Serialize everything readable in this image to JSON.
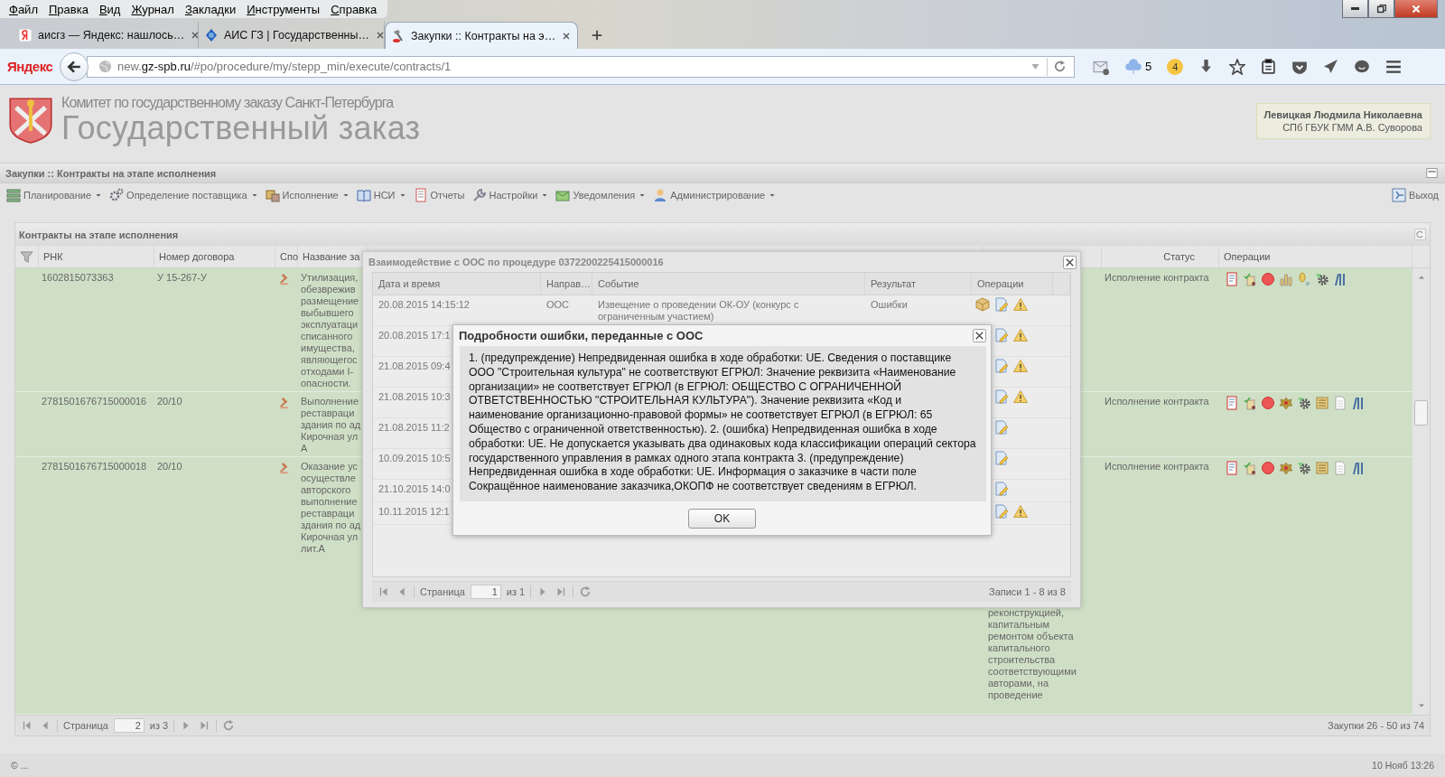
{
  "menu_bar": [
    "Файл",
    "Правка",
    "Вид",
    "Журнал",
    "Закладки",
    "Инструменты",
    "Справка"
  ],
  "browser_tabs": [
    {
      "title": "аисгз — Яндекс: нашлось…",
      "selected": false,
      "kind": "yandex"
    },
    {
      "title": "АИС ГЗ | Государственны…",
      "selected": false,
      "kind": "globe"
    },
    {
      "title": "Закупки :: Контракты на э…",
      "selected": true,
      "kind": "hammer"
    }
  ],
  "address_bar": {
    "brand": "Яндекс",
    "url": "new.**gz-spb.ru**/#po/procedure/my/stepp_min/execute/contracts/1",
    "cloud_count": "5",
    "badge_count": "4"
  },
  "header": {
    "subtitle": "Комитет по государственному заказу Санкт-Петербурга",
    "title": "Государственный заказ",
    "user_name": "Левицкая Людмила Николаевна",
    "user_org": "СПб ГБУК ГММ А.В. Суворова"
  },
  "section_title": "Закупки :: Контракты на этапе исполнения",
  "nav_menu": [
    {
      "label": "Планирование",
      "has_menu": true,
      "kind": "planning"
    },
    {
      "label": "Определение поставщика",
      "has_menu": true,
      "kind": "supplier"
    },
    {
      "label": "Исполнение",
      "has_menu": true,
      "kind": "execution"
    },
    {
      "label": "НСИ",
      "has_menu": true,
      "kind": "nsi"
    },
    {
      "label": "Отчеты",
      "has_menu": false,
      "kind": "reports"
    },
    {
      "label": "Настройки",
      "has_menu": true,
      "kind": "settings"
    },
    {
      "label": "Уведомления",
      "has_menu": true,
      "kind": "notifications"
    },
    {
      "label": "Администрирование",
      "has_menu": true,
      "kind": "admin"
    }
  ],
  "logout": "Выход",
  "grid": {
    "title": "Контракты на этапе исполнения",
    "columns": [
      "РНК",
      "Номер договора",
      "Спо",
      "Название за",
      "Статус",
      "Операции"
    ],
    "rows": [
      {
        "rnk": "1602815073363",
        "number": "У 15-267-У",
        "name": "Утилизация,\nобезврежив\nразмещение\nвыбывшего\nэксплуатаци\nсписанного\nимущества,\nявляющегос\nотходами I-\nопасности.",
        "column_6": "",
        "status": "Исполнение контракта",
        "operations": [
          {
            "kind": "report"
          },
          {
            "kind": "approve"
          },
          {
            "kind": "stop"
          },
          {
            "kind": "chart"
          },
          {
            "kind": "coin"
          },
          {
            "kind": "gear"
          },
          {
            "kind": "books"
          }
        ]
      },
      {
        "rnk": "2781501676715000016",
        "number": "20/10",
        "name": "Выполнение\nреставраци\nздания по ад\nКирочная ул\nА",
        "column_6": "",
        "status": "Исполнение контракта",
        "operations": [
          {
            "kind": "report"
          },
          {
            "kind": "approve"
          },
          {
            "kind": "stop"
          },
          {
            "kind": "emblem"
          },
          {
            "kind": "gear"
          },
          {
            "kind": "scroll"
          },
          {
            "kind": "page"
          },
          {
            "kind": "books"
          }
        ]
      },
      {
        "rnk": "2781501676715000018",
        "number": "20/10",
        "name": "Оказание ус\nосуществле\nавторского\nвыполнение\nреставраци\nздания по ад\nКирочная ул\nлит.А",
        "column_6": "реконструкцией,\nкапитальным\nремонтом объекта\nкапитального\nстроительства\nсоответствующими\nавторами, на\nпроведение",
        "status": "Исполнение контракта",
        "operations": [
          {
            "kind": "report"
          },
          {
            "kind": "approve"
          },
          {
            "kind": "stop"
          },
          {
            "kind": "emblem"
          },
          {
            "kind": "gear"
          },
          {
            "kind": "scroll"
          },
          {
            "kind": "page"
          },
          {
            "kind": "books"
          }
        ]
      }
    ],
    "pager": {
      "page_label": "Страница",
      "page": "2",
      "of": "из 3",
      "summary": "Закупки 26 - 50 из 74"
    }
  },
  "interaction_dialog": {
    "title": "Взаимодействие с ООС по процедуре 0372200225415000016",
    "columns": [
      "Дата и время",
      "Направ…",
      "Событие",
      "Результат",
      "Операции"
    ],
    "rows": [
      {
        "date": "20.08.2015 14:15:12",
        "direction": "ООС",
        "event": "Извещение о проведении ОК-ОУ (конкурс с ограниченным участием)",
        "result": "Ошибки",
        "operations": [
          {
            "kind": "package"
          },
          {
            "kind": "edit"
          },
          {
            "kind": "warning"
          }
        ]
      },
      {
        "date": "20.08.2015 17:1",
        "operations": [
          {
            "kind": "edit"
          },
          {
            "kind": "warning"
          }
        ]
      },
      {
        "date": "21.08.2015 09:4",
        "operations": [
          {
            "kind": "edit"
          },
          {
            "kind": "warning"
          }
        ]
      },
      {
        "date": "21.08.2015 10:3",
        "operations": [
          {
            "kind": "edit"
          },
          {
            "kind": "warning"
          }
        ]
      },
      {
        "date": "21.08.2015 11:2",
        "operations": [
          {
            "kind": "edit"
          }
        ]
      },
      {
        "date": "10.09.2015 10:5",
        "operations": [
          {
            "kind": "edit"
          }
        ]
      },
      {
        "date": "21.10.2015 14:0",
        "operations": [
          {
            "kind": "edit"
          }
        ]
      },
      {
        "date": "10.11.2015 12:1",
        "operations": [
          {
            "kind": "edit"
          },
          {
            "kind": "warning"
          }
        ]
      }
    ],
    "pager": {
      "page_label": "Страница",
      "page": "1",
      "of": "из 1",
      "summary": "Записи 1 - 8 из 8"
    }
  },
  "error_dialog": {
    "title": "Подробности ошибки, переданные с ООС",
    "message": "1. (предупреждение) Непредвиденная ошибка в ходе обработки: UE. Сведения о поставщике ООО \"Строительная культура\" не соответствуют ЕГРЮЛ: Значение реквизита «Наименование организации» не соответствует ЕГРЮЛ (в ЕГРЮЛ: ОБЩЕСТВО С ОГРАНИЧЕННОЙ ОТВЕТСТВЕННОСТЬЮ \"СТРОИТЕЛЬНАЯ КУЛЬТУРА\"). Значение реквизита «Код и наименование организационно-правовой формы» не соответствует ЕГРЮЛ (в ЕГРЮЛ: 65 Общество с ограниченной ответственностью). 2. (ошибка) Непредвиденная ошибка в ходе обработки: UE. Не допускается указывать два одинаковых кода классификации операций сектора государственного управления в рамках одного этапа контракта 3. (предупреждение) Непредвиденная ошибка в ходе обработки: UE. Информация о заказчике в части поле Сокращённое наименование заказчика,ОКОПФ не соответствует сведениям в ЕГРЮЛ.",
    "ok": "OK"
  },
  "status_bar": {
    "left": "© ...",
    "right": "10 Нояб 13:26"
  }
}
